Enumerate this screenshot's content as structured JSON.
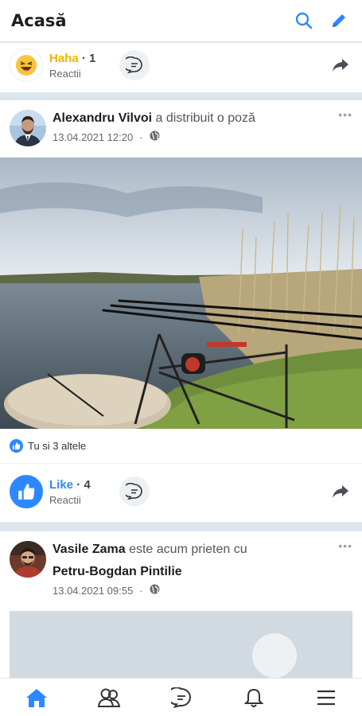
{
  "header": {
    "title": "Acasă",
    "icons": [
      "search-icon",
      "pencil-icon"
    ]
  },
  "colors": {
    "accent": "#2d88ff",
    "haha": "#f2b400",
    "divider": "#dde6ee"
  },
  "top_reaction_bar": {
    "reaction_label": "Haha",
    "count": "· 1",
    "sub": "Reactii"
  },
  "post1": {
    "author": "Alexandru Vilvoi",
    "action": "a distribuit o poză",
    "timestamp": "13.04.2021 12:20",
    "dot": "·",
    "likers": "Tu si 3 altele",
    "reaction_label": "Like",
    "count": "· 4",
    "sub": "Reactii"
  },
  "post2": {
    "author": "Vasile Zama",
    "action": "este acum prieten cu",
    "friend": "Petru-Bogdan Pintilie",
    "timestamp": "13.04.2021 09:55",
    "dot": "·"
  },
  "bottom_nav": [
    "home-icon",
    "friends-icon",
    "messenger-icon",
    "bell-icon",
    "menu-icon"
  ]
}
